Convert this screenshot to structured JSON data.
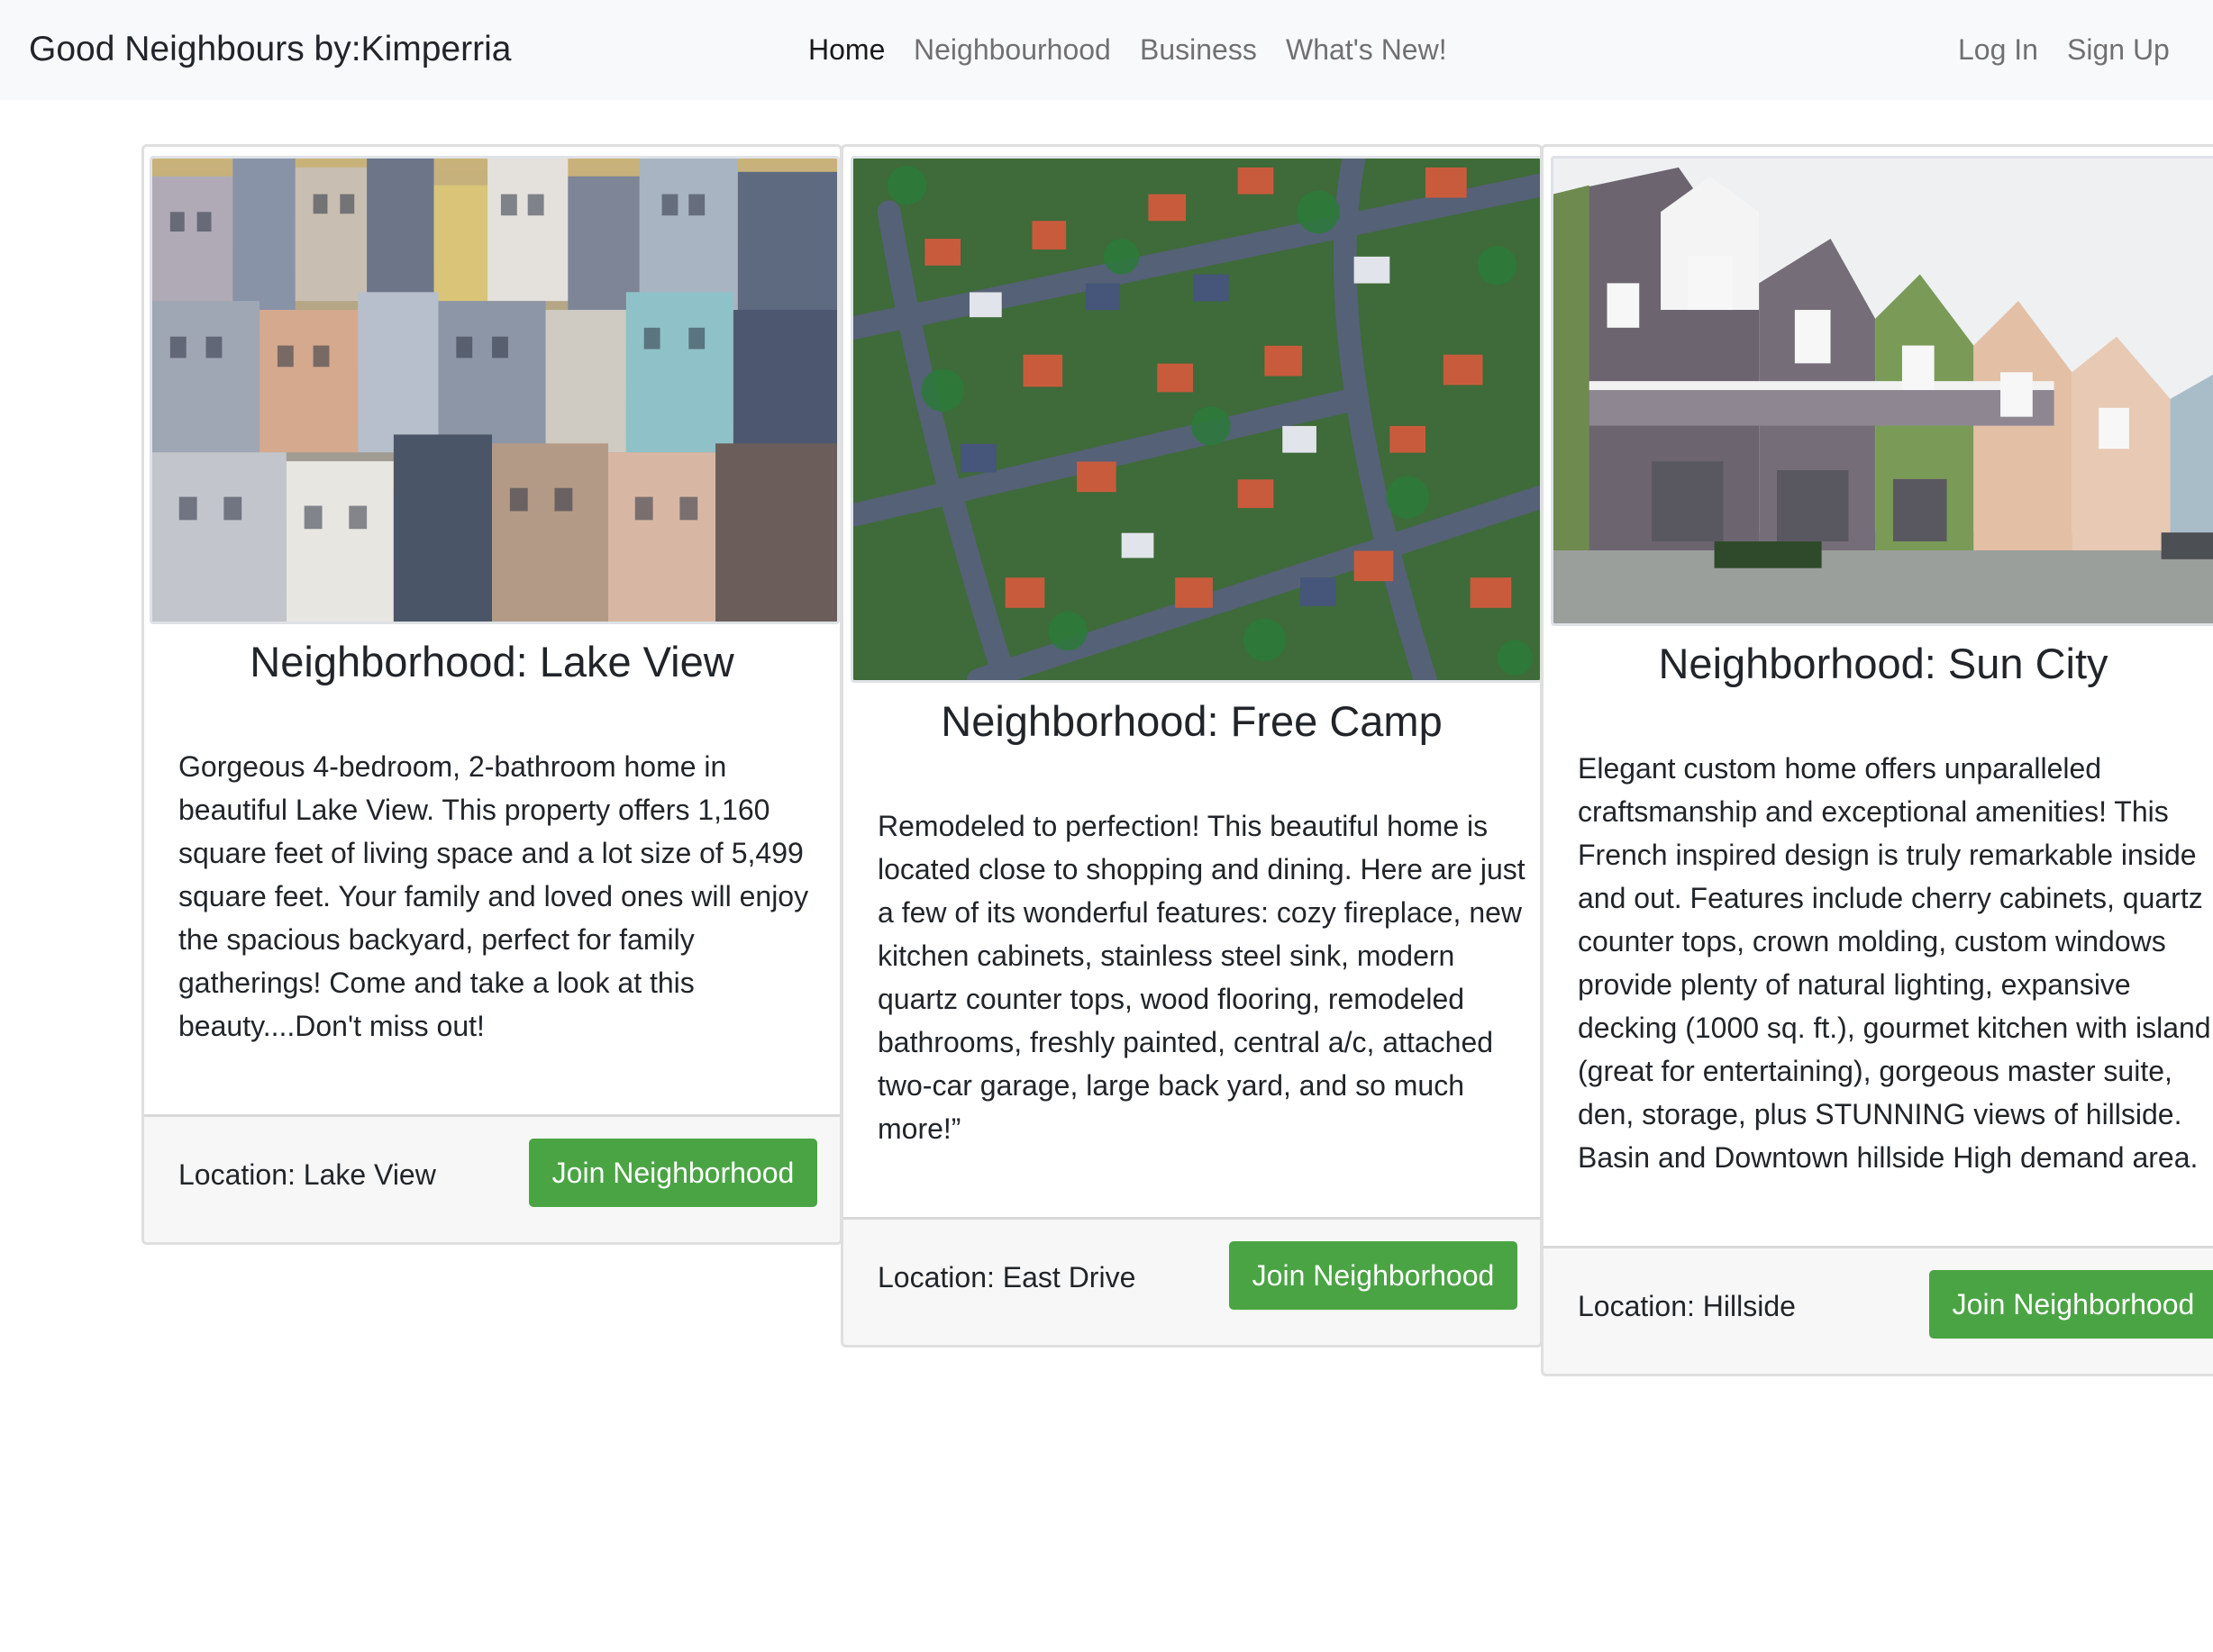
{
  "navbar": {
    "brand": "Good Neighbours by:Kimperria",
    "links": [
      {
        "label": "Home",
        "active": true
      },
      {
        "label": "Neighbourhood",
        "active": false
      },
      {
        "label": "Business",
        "active": false
      },
      {
        "label": "What's New!",
        "active": false
      }
    ],
    "login": "Log In",
    "signup": "Sign Up"
  },
  "cards": [
    {
      "title": "Neighborhood: Lake View",
      "description": "Gorgeous 4-bedroom, 2-bathroom home in beautiful Lake View. This property offers 1,160 square feet of living space and a lot size of 5,499 square feet. Your family and loved ones will enjoy the spacious backyard, perfect for family gatherings! Come and take a look at this beauty....Don't miss out!",
      "location": "Location: Lake View",
      "button": "Join Neighborhood",
      "image": "dense-city-buildings-photo"
    },
    {
      "title": "Neighborhood: Free Camp",
      "description": "Remodeled to perfection! This beautiful home is located close to shopping and dining. Here are just a few of its wonderful features: cozy fireplace, new kitchen cabinets, stainless steel sink, modern quartz counter tops, wood flooring, remodeled bathrooms, freshly painted, central a/c, attached two-car garage, large back yard, and so much more!”",
      "location": "Location: East Drive",
      "button": "Join Neighborhood",
      "image": "aerial-suburb-photo"
    },
    {
      "title": "Neighborhood: Sun City",
      "description": "Elegant custom home offers unparalleled craftsmanship and exceptional amenities! This French inspired design is truly remarkable inside and out. Features include cherry cabinets, quartz counter tops, crown molding, custom windows provide plenty of natural lighting, expansive decking (1000 sq. ft.), gourmet kitchen with island (great for entertaining), gorgeous master suite, den, storage, plus STUNNING views of hillside. Basin and Downtown hillside High demand area.",
      "location": "Location: Hillside",
      "button": "Join Neighborhood",
      "image": "townhouses-row-photo"
    }
  ],
  "colors": {
    "navbar_bg": "#f8f9fa",
    "button_green": "#4aa444",
    "footer_bg": "#f7f7f7"
  }
}
